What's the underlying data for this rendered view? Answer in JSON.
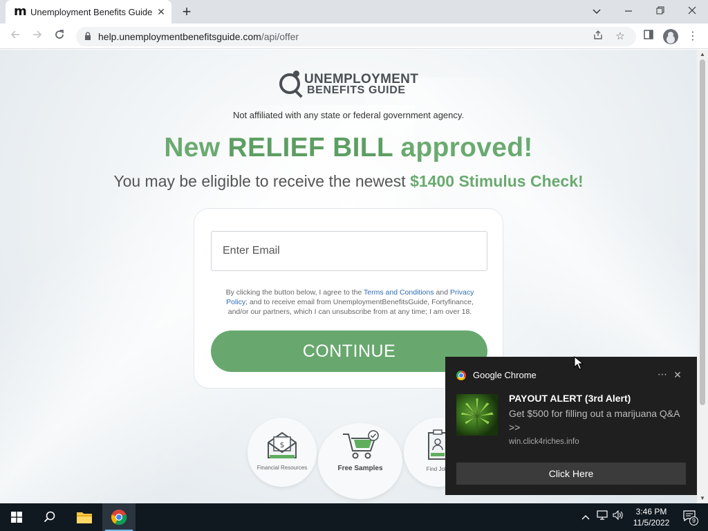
{
  "browser": {
    "tab": {
      "title": "Unemployment Benefits Guide",
      "favicon": "m"
    },
    "url": {
      "host": "help.unemploymentbenefitsguide.com",
      "path": "/api/offer"
    }
  },
  "page": {
    "logo": {
      "line1": "UNEMPLOYMENT",
      "line2": "BENEFITS GUIDE"
    },
    "disclaimer": "Not affiliated with any state or federal government agency.",
    "headline": {
      "prefix": "New ",
      "emphasis": "RELIEF BILL",
      "suffix": " approved!"
    },
    "subhead": {
      "text": "You may be eligible to receive the newest ",
      "highlight": "$1400 Stimulus Check!"
    },
    "form": {
      "email_placeholder": "Enter Email",
      "consent_prefix": "By clicking the button below, I agree to the ",
      "terms_link": "Terms and Conditions",
      "consent_and": " and ",
      "privacy_link": "Privacy Policy",
      "consent_suffix": "; and to receive email from UnemploymentBenefitsGuide, Fortyfinance, and/or our partners, which I can unsubscribe from at any time; I am over 18.",
      "continue_label": "CONTINUE"
    },
    "features": [
      {
        "label": "Financial Resources",
        "icon": "envelope-dollar-icon"
      },
      {
        "label": "Free Samples",
        "icon": "shopping-cart-icon"
      },
      {
        "label": "Find Jobs",
        "icon": "clipboard-person-icon"
      }
    ]
  },
  "notification": {
    "app": "Google Chrome",
    "title": "PAYOUT ALERT (3rd Alert)",
    "body": "Get $500 for filling out a marijuana Q&A >>",
    "source": "win.click4riches.info",
    "button": "Click Here",
    "image": "cannabis-leaf-image"
  },
  "taskbar": {
    "time": "3:46 PM",
    "date": "11/5/2022",
    "notification_count": "9"
  },
  "colors": {
    "accent_green": "#68a86e",
    "toast_bg": "#1f1f1f",
    "taskbar_bg": "#101820"
  }
}
